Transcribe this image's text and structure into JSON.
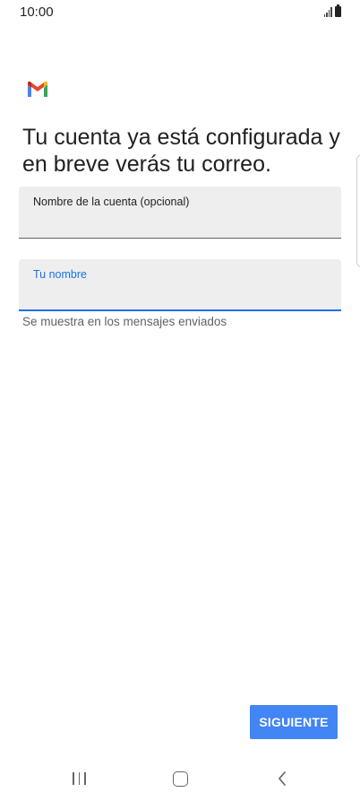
{
  "status_bar": {
    "time": "10:00"
  },
  "app": {
    "logo_icon": "gmail-logo-icon",
    "colors": {
      "gmail_red": "#EA4335",
      "gmail_blue": "#4285F4",
      "gmail_green": "#34A853",
      "gmail_yellow": "#FBBC04",
      "accent": "#1A73E8",
      "button": "#4285F4"
    }
  },
  "main": {
    "heading": "Tu cuenta ya está configurada y en breve verás tu correo.",
    "account_name_field": {
      "label": "Nombre de la cuenta (opcional)",
      "value": ""
    },
    "your_name_field": {
      "label": "Tu nombre",
      "value": "",
      "helper": "Se muestra en los mensajes enviados"
    },
    "next_button": "SIGUIENTE"
  },
  "nav_bar": {
    "recents_icon": "recents-icon",
    "home_icon": "home-icon",
    "back_icon": "back-icon"
  }
}
